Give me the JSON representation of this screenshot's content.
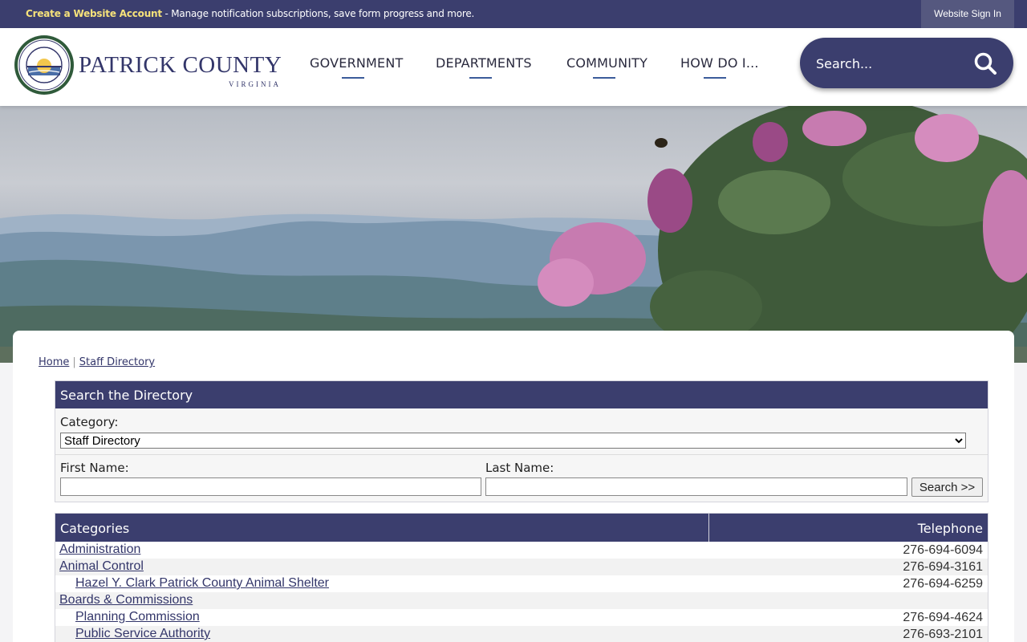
{
  "topbar": {
    "create_link": "Create a Website Account",
    "create_desc": " - Manage notification subscriptions, save form progress and more.",
    "signin": "Website Sign In"
  },
  "brand": {
    "name": "PATRICK COUNTY",
    "state": "VIRGINIA"
  },
  "nav": [
    {
      "label": "GOVERNMENT"
    },
    {
      "label": "DEPARTMENTS"
    },
    {
      "label": "COMMUNITY"
    },
    {
      "label": "HOW DO I..."
    }
  ],
  "search": {
    "placeholder": "Search..."
  },
  "breadcrumb": {
    "home": "Home",
    "sep": "|",
    "current": "Staff Directory"
  },
  "directory_search": {
    "title": "Search the Directory",
    "category_label": "Category:",
    "category_value": "Staff Directory",
    "first_label": "First Name:",
    "last_label": "Last Name:",
    "button": "Search >>"
  },
  "table": {
    "col_categories": "Categories",
    "col_telephone": "Telephone",
    "rows": [
      {
        "name": "Administration",
        "phone": "276-694-6094",
        "indent": false
      },
      {
        "name": "Animal Control",
        "phone": "276-694-3161",
        "indent": false
      },
      {
        "name": "Hazel Y. Clark Patrick County Animal Shelter",
        "phone": "276-694-6259",
        "indent": true
      },
      {
        "name": "Boards & Commissions",
        "phone": "",
        "indent": false
      },
      {
        "name": "Planning Commission",
        "phone": "276-694-4624",
        "indent": true
      },
      {
        "name": "Public Service Authority",
        "phone": "276-693-2101",
        "indent": true
      }
    ]
  },
  "colors": {
    "primary": "#3b3e6e",
    "accent": "#f6e27a",
    "link": "#33366a"
  }
}
